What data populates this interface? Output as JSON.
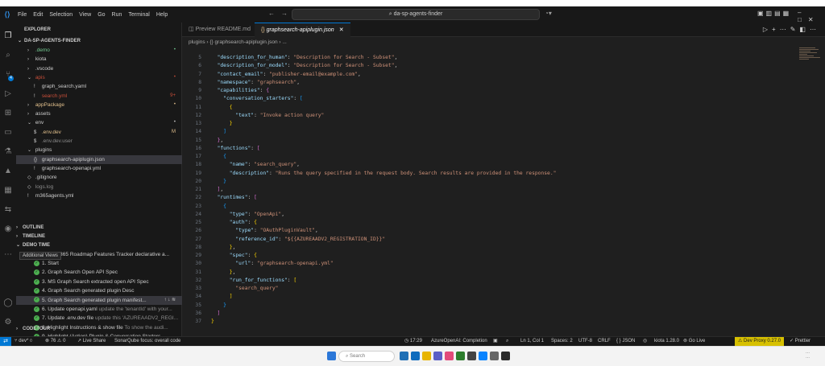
{
  "window": {
    "menu": [
      "File",
      "Edit",
      "Selection",
      "View",
      "Go",
      "Run",
      "Terminal",
      "Help"
    ],
    "command_center": "da-sp-agents-finder"
  },
  "sidebar": {
    "explorer_title": "EXPLORER",
    "root": "DA-SP-AGENTS-FINDER",
    "tree": [
      {
        "label": ".demo",
        "indent": 1,
        "kind": "folder",
        "chev": "›",
        "deco": "•",
        "status": "untracked"
      },
      {
        "label": "kiota",
        "indent": 1,
        "kind": "folder",
        "chev": "›",
        "deco": "",
        "status": ""
      },
      {
        "label": ".vscode",
        "indent": 1,
        "kind": "folder",
        "chev": "›",
        "deco": "",
        "status": ""
      },
      {
        "label": "apis",
        "indent": 1,
        "kind": "folder",
        "chev": "⌄",
        "deco": "•",
        "status": "deleted"
      },
      {
        "label": "graph_search.yaml",
        "indent": 2,
        "kind": "file",
        "chev": "",
        "deco": "",
        "status": ""
      },
      {
        "label": "search.yml",
        "indent": 2,
        "kind": "file",
        "chev": "",
        "deco": "9+",
        "status": "deleted"
      },
      {
        "label": "appPackage",
        "indent": 1,
        "kind": "folder",
        "chev": "›",
        "deco": "•",
        "status": "modified"
      },
      {
        "label": "assets",
        "indent": 1,
        "kind": "folder",
        "chev": "›",
        "deco": "",
        "status": ""
      },
      {
        "label": "env",
        "indent": 1,
        "kind": "folder",
        "chev": "⌄",
        "deco": "•",
        "status": ""
      },
      {
        "label": ".env.dev",
        "indent": 2,
        "kind": "file",
        "chev": "",
        "deco": "M",
        "status": "modified"
      },
      {
        "label": ".env.dev.user",
        "indent": 2,
        "kind": "file",
        "chev": "",
        "deco": "",
        "status": "dim"
      },
      {
        "label": "plugins",
        "indent": 1,
        "kind": "folder",
        "chev": "⌄",
        "deco": "",
        "status": ""
      },
      {
        "label": "graphsearch-apiplugin.json",
        "indent": 2,
        "kind": "file",
        "chev": "",
        "deco": "",
        "status": "selected"
      },
      {
        "label": "graphsearch-openapi.yml",
        "indent": 2,
        "kind": "file",
        "chev": "",
        "deco": "",
        "status": ""
      },
      {
        "label": ".gitignore",
        "indent": 1,
        "kind": "file",
        "chev": "",
        "deco": "",
        "status": ""
      },
      {
        "label": "logs.log",
        "indent": 1,
        "kind": "file",
        "chev": "",
        "deco": "",
        "status": "dim"
      },
      {
        "label": "m365agents.yml",
        "indent": 1,
        "kind": "file",
        "chev": "",
        "deco": "",
        "status": ""
      }
    ],
    "outline": "OUTLINE",
    "timeline": "TIMELINE",
    "demo_time": "DEMO TIME",
    "demo_group": "Microsoft 365 Roadmap Features Tracker declarative a...",
    "steps": [
      {
        "label": "1. Start",
        "hint": ""
      },
      {
        "label": "2. Graph Search Open API Spec",
        "hint": ""
      },
      {
        "label": "3. MS Graph Search extracted open API Spec",
        "hint": ""
      },
      {
        "label": "4. Graph Search generated plugin Desc",
        "hint": ""
      },
      {
        "label": "5. Graph Search generated plugin manifest...",
        "hint": "",
        "selected": true
      },
      {
        "label": "6. Update openapi.yaml",
        "hint": "update the 'tenantId' with your..."
      },
      {
        "label": "7. Update .env.dev file",
        "hint": "update this 'AZUREAADV2_REGI..."
      },
      {
        "label": "8. Highlight Instructions & show file",
        "hint": "To show the audi..."
      },
      {
        "label": "9. Highlight (Action) Plugin & Conversation Starters",
        "hint": ""
      }
    ],
    "tooltip": "Additional Views",
    "codetour": "CODETOUR"
  },
  "tabs": [
    {
      "label": "Preview README.md",
      "icon": "preview-icon",
      "active": false
    },
    {
      "label": "graphsearch-apiplugin.json",
      "icon": "braces-icon",
      "active": true
    }
  ],
  "breadcrumbs": [
    "plugins",
    "{} graphsearch-apiplugin.json",
    "..."
  ],
  "code": [
    {
      "n": "5",
      "html": "  <span class=\"k\">\"description_for_human\"</span><span class=\"p\">: </span><span class=\"s\">\"Description for Search - Subset\"</span><span class=\"p\">,</span>"
    },
    {
      "n": "6",
      "html": "  <span class=\"k\">\"description_for_model\"</span><span class=\"p\">: </span><span class=\"s\">\"Description for Search - Subset\"</span><span class=\"p\">,</span>"
    },
    {
      "n": "7",
      "html": "  <span class=\"k\">\"contact_email\"</span><span class=\"p\">: </span><span class=\"s\">\"publisher-email@example.com\"</span><span class=\"p\">,</span>"
    },
    {
      "n": "8",
      "html": "  <span class=\"k\">\"namespace\"</span><span class=\"p\">: </span><span class=\"s\">\"graphsearch\"</span><span class=\"p\">,</span>"
    },
    {
      "n": "9",
      "html": "  <span class=\"k\">\"capabilities\"</span><span class=\"p\">: </span><span class=\"b2\">{</span>"
    },
    {
      "n": "10",
      "html": "    <span class=\"k\">\"conversation_starters\"</span><span class=\"p\">: </span><span class=\"b3\">[</span>"
    },
    {
      "n": "11",
      "html": "      <span class=\"b1\">{</span>"
    },
    {
      "n": "12",
      "html": "        <span class=\"k\">\"text\"</span><span class=\"p\">: </span><span class=\"s\">\"Invoke action query\"</span>"
    },
    {
      "n": "13",
      "html": "      <span class=\"b1\">}</span>"
    },
    {
      "n": "14",
      "html": "    <span class=\"b3\">]</span>"
    },
    {
      "n": "15",
      "html": "  <span class=\"b2\">}</span><span class=\"p\">,</span>"
    },
    {
      "n": "16",
      "html": "  <span class=\"k\">\"functions\"</span><span class=\"p\">: </span><span class=\"b2\">[</span>"
    },
    {
      "n": "17",
      "html": "    <span class=\"b3\">{</span>"
    },
    {
      "n": "18",
      "html": "      <span class=\"k\">\"name\"</span><span class=\"p\">: </span><span class=\"s\">\"search_query\"</span><span class=\"p\">,</span>"
    },
    {
      "n": "19",
      "html": "      <span class=\"k\">\"description\"</span><span class=\"p\">: </span><span class=\"s\">\"Runs the query specified in the request body. Search results are provided in the response.\"</span>"
    },
    {
      "n": "20",
      "html": "    <span class=\"b3\">}</span>"
    },
    {
      "n": "21",
      "html": "  <span class=\"b2\">]</span><span class=\"p\">,</span>"
    },
    {
      "n": "22",
      "html": "  <span class=\"k\">\"runtimes\"</span><span class=\"p\">: </span><span class=\"b2\">[</span>"
    },
    {
      "n": "23",
      "html": "    <span class=\"b3\">{</span>"
    },
    {
      "n": "24",
      "html": "      <span class=\"k\">\"type\"</span><span class=\"p\">: </span><span class=\"s\">\"OpenApi\"</span><span class=\"p\">,</span>"
    },
    {
      "n": "25",
      "html": "      <span class=\"k\">\"auth\"</span><span class=\"p\">: </span><span class=\"b1\">{</span>"
    },
    {
      "n": "26",
      "html": "        <span class=\"k\">\"type\"</span><span class=\"p\">: </span><span class=\"s\">\"OAuthPluginVault\"</span><span class=\"p\">,</span>"
    },
    {
      "n": "27",
      "html": "        <span class=\"k\">\"reference_id\"</span><span class=\"p\">: </span><span class=\"s\">\"${{AZUREAADV2_REGISTRATION_ID}}\"</span>"
    },
    {
      "n": "28",
      "html": "      <span class=\"b1\">}</span><span class=\"p\">,</span>"
    },
    {
      "n": "29",
      "html": "      <span class=\"k\">\"spec\"</span><span class=\"p\">: </span><span class=\"b1\">{</span>"
    },
    {
      "n": "30",
      "html": "        <span class=\"k\">\"url\"</span><span class=\"p\">: </span><span class=\"s\">\"graphsearch-openapi.yml\"</span>"
    },
    {
      "n": "31",
      "html": "      <span class=\"b1\">}</span><span class=\"p\">,</span>"
    },
    {
      "n": "32",
      "html": "      <span class=\"k\">\"run_for_functions\"</span><span class=\"p\">: </span><span class=\"b1\">[</span>"
    },
    {
      "n": "33",
      "html": "        <span class=\"s\">\"search_query\"</span>"
    },
    {
      "n": "34",
      "html": "      <span class=\"b1\">]</span>"
    },
    {
      "n": "35",
      "html": "    <span class=\"b3\">}</span>"
    },
    {
      "n": "36",
      "html": "  <span class=\"b2\">]</span>"
    },
    {
      "n": "37",
      "html": "<span class=\"b1\">}</span>"
    }
  ],
  "status": {
    "branch": "dev*",
    "problems": "⊗ 76 ⚠ 0",
    "live_share": "Live Share",
    "sonar": "SonarQube focus: overall code",
    "time": "17:29",
    "azure": "AzureOpenAI: Completion",
    "cursor": "Ln 1, Col 1",
    "spaces": "Spaces: 2",
    "encoding": "UTF-8",
    "eol": "CRLF",
    "language": "{ } JSON",
    "kiota": "kiota 1.28.0",
    "go_live": "Go Live",
    "dev_proxy": "Dev Proxy 0.27.0",
    "prettier": "Prettier"
  },
  "taskbar": {
    "search_placeholder": "Search"
  },
  "colors": {
    "accent": "#0078d4",
    "modified": "#e2c08d",
    "untracked": "#73c991",
    "deleted": "#c74e39",
    "dev_proxy": "#d7c000"
  }
}
